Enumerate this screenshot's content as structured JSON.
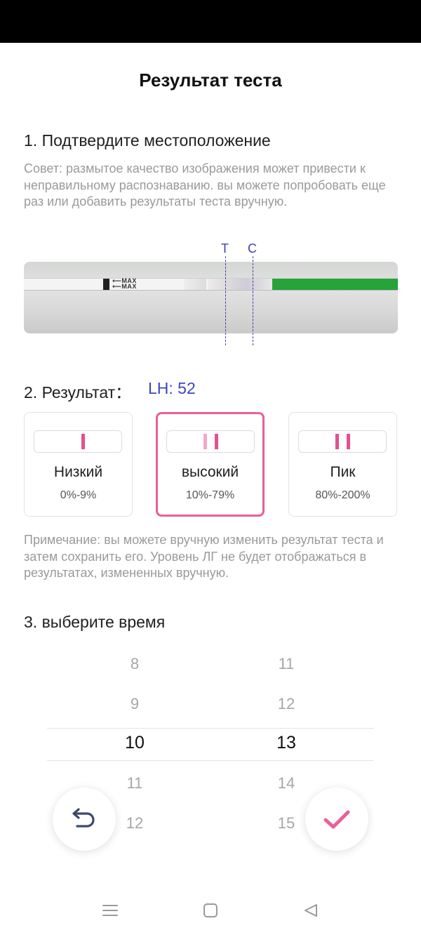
{
  "header": {
    "title": "Результат теста"
  },
  "section1": {
    "heading": "1. Подтвердите местоположение",
    "hint": "Совет: размытое качество изображения может привести к неправильному распознаванию. вы можете попробовать еще раз или добавить результаты теста вручную.",
    "strip_max_text": "MAX",
    "t_label": "T",
    "c_label": "C"
  },
  "section2": {
    "heading": "2. Результат：",
    "lh_value": "LH: 52",
    "options": [
      {
        "title": "Низкий",
        "range": "0%-9%",
        "selected": false
      },
      {
        "title": "высокий",
        "range": "10%-79%",
        "selected": true
      },
      {
        "title": "Пик",
        "range": "80%-200%",
        "selected": false
      }
    ],
    "note": "Примечание: вы можете вручную изменить результат теста и затем сохранить его. Уровень ЛГ не будет отображаться в результатах, измененных вручную."
  },
  "section3": {
    "heading": "3. выберите время",
    "hours": [
      "8",
      "9",
      "10",
      "11",
      "12"
    ],
    "minutes": [
      "11",
      "12",
      "13",
      "14",
      "15"
    ],
    "selected_hour": "10",
    "selected_minute": "13"
  },
  "icons": {
    "back": "undo-arrow-icon",
    "confirm": "checkmark-icon",
    "nav_menu": "menu-icon",
    "nav_home": "home-square-icon",
    "nav_back": "back-triangle-icon"
  },
  "colors": {
    "accent_pink": "#e8609a",
    "accent_blue": "#3d44c4",
    "strip_green": "#27a33a"
  }
}
